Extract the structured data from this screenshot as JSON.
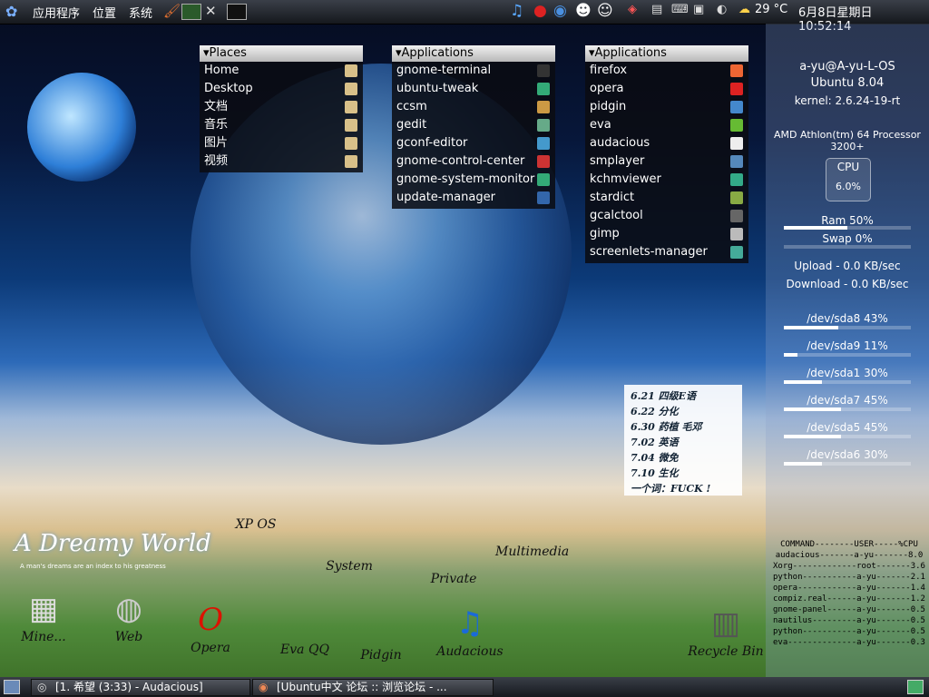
{
  "top_panel": {
    "menus": [
      "应用程序",
      "位置",
      "系统"
    ],
    "temperature": "29 °C",
    "datetime": "6月8日星期日 10:52:14"
  },
  "places": {
    "title": "Places",
    "items": [
      "Home",
      "Desktop",
      "文档",
      "音乐",
      "图片",
      "视频"
    ]
  },
  "apps_left": {
    "title": "Applications",
    "items": [
      "gnome-terminal",
      "ubuntu-tweak",
      "ccsm",
      "gedit",
      "gconf-editor",
      "gnome-control-center",
      "gnome-system-monitor",
      "update-manager"
    ]
  },
  "apps_right": {
    "title": "Applications",
    "items": [
      "firefox",
      "opera",
      "pidgin",
      "eva",
      "audacious",
      "smplayer",
      "kchmviewer",
      "stardict",
      "gcalctool",
      "gimp",
      "screenlets-manager"
    ]
  },
  "sysmon": {
    "user": "a-yu@A-yu-L-OS",
    "os": "Ubuntu 8.04",
    "kernel": "kernel: 2.6.24-19-rt",
    "cpu_model": "AMD Athlon(tm) 64 Processor 3200+",
    "cpu_label": "CPU",
    "cpu_value": "6.0%",
    "ram": "Ram 50%",
    "ram_fraction": 0.5,
    "swap": "Swap 0%",
    "swap_fraction": 0.0,
    "upload": "Upload - 0.0 KB/sec",
    "download": "Download - 0.0 KB/sec",
    "disks": [
      {
        "label": "/dev/sda8 43%",
        "fraction": 0.43
      },
      {
        "label": "/dev/sda9 11%",
        "fraction": 0.11
      },
      {
        "label": "/dev/sda1 30%",
        "fraction": 0.3
      },
      {
        "label": "/dev/sda7 45%",
        "fraction": 0.45
      },
      {
        "label": "/dev/sda5 45%",
        "fraction": 0.45
      },
      {
        "label": "/dev/sda6 30%",
        "fraction": 0.3
      }
    ]
  },
  "processes": [
    "COMMAND--------USER-----%CPU",
    "audacious-------a-yu-------8.0",
    "Xorg-------------root-------3.6",
    "python-----------a-yu-------2.1",
    "opera------------a-yu-------1.4",
    "compiz.real------a-yu-------1.2",
    "gnome-panel------a-yu-------0.5",
    "nautilus---------a-yu-------0.5",
    "python-----------a-yu-------0.5",
    "eva--------------a-yu-------0.3"
  ],
  "note": {
    "lines": [
      "6.21 四级E语",
      "6.22 分化",
      "6.30 药植 毛邓",
      "7.02 英语",
      "7.04 微免",
      "7.10 生化",
      "一个词：FUCK !"
    ]
  },
  "wallpaper": {
    "title": "A Dreamy World",
    "subtitle": "A man's dreams are an index to his greatness"
  },
  "desktop_icons": {
    "xp_os": "XP OS",
    "system": "System",
    "private": "Private",
    "multimedia": "Multimedia",
    "mine": "Mine...",
    "web": "Web",
    "opera": "Opera",
    "eva_qq": "Eva QQ",
    "pidgin": "Pidgin",
    "audacious": "Audacious",
    "recycle_bin": "Recycle Bin"
  },
  "taskbar": {
    "tasks": [
      "[1. 希望 (3:33) - Audacious]",
      "[Ubuntu中文 论坛 :: 浏览论坛 - ..."
    ]
  }
}
